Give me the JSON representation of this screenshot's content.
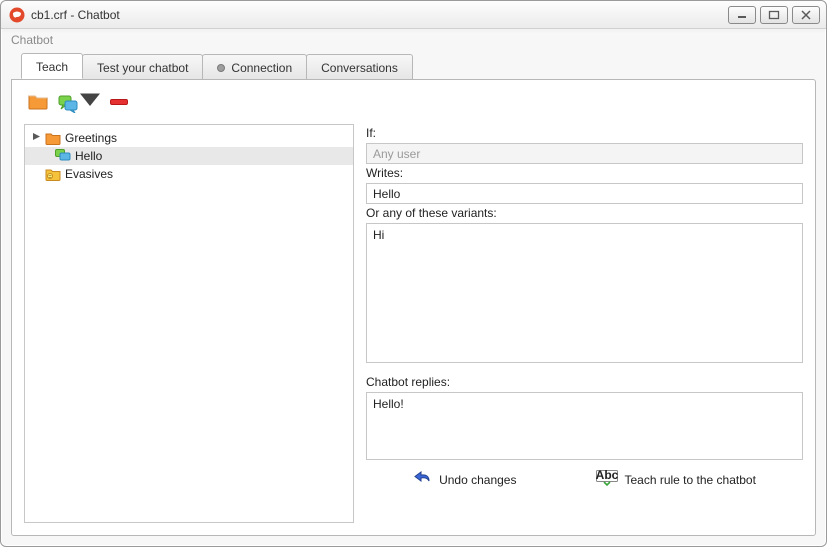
{
  "window": {
    "title": "cb1.crf - Chatbot"
  },
  "menubar": {
    "menu_main": "Chatbot"
  },
  "tabs": {
    "teach": "Teach",
    "test": "Test your chatbot",
    "connection": "Connection",
    "conversations": "Conversations",
    "active": "teach"
  },
  "tree": {
    "items": [
      {
        "label": "Greetings",
        "type": "folder",
        "expanded": true
      },
      {
        "label": "Hello",
        "type": "rule",
        "selected": true
      },
      {
        "label": "Evasives",
        "type": "folder-special",
        "expanded": false
      }
    ]
  },
  "form": {
    "if_label": "If:",
    "if_value": "Any user",
    "writes_label": "Writes:",
    "writes_value": "Hello",
    "variants_label": "Or any of these variants:",
    "variants_value": "Hi",
    "replies_label": "Chatbot replies:",
    "replies_value": "Hello!"
  },
  "actions": {
    "undo": "Undo changes",
    "teach": "Teach rule to the chatbot"
  }
}
